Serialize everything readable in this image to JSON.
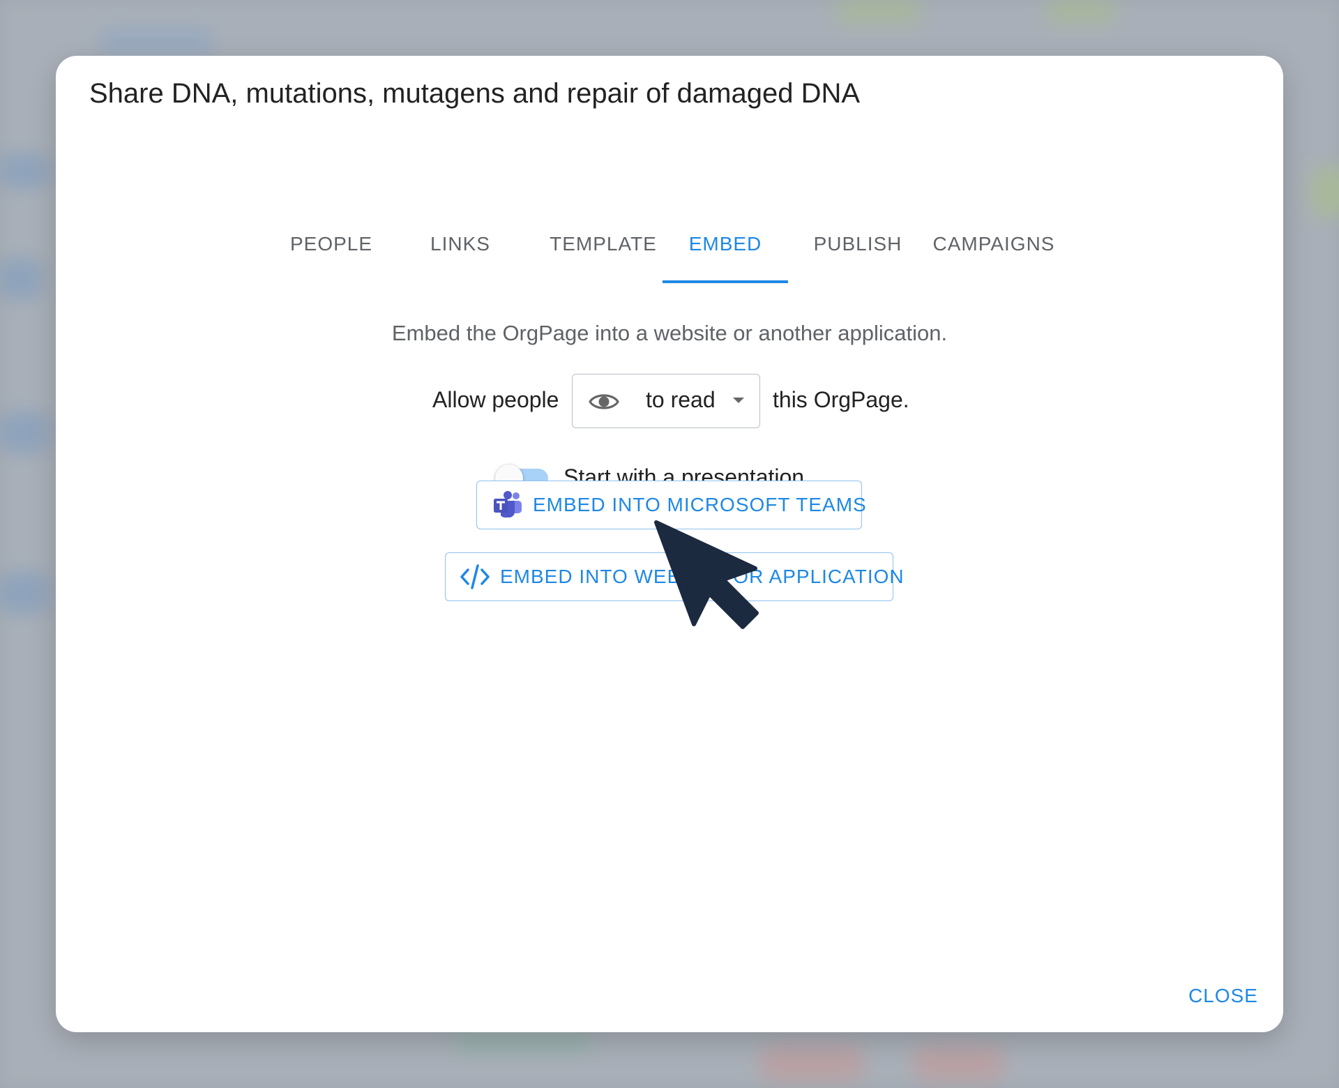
{
  "dialog": {
    "title": "Share DNA, mutations, mutagens and repair of damaged DNA",
    "close_label": "CLOSE"
  },
  "tabs": [
    {
      "label": "PEOPLE",
      "active": false
    },
    {
      "label": "LINKS",
      "active": false
    },
    {
      "label": "TEMPLATE",
      "active": false
    },
    {
      "label": "EMBED",
      "active": true
    },
    {
      "label": "PUBLISH",
      "active": false
    },
    {
      "label": "CAMPAIGNS",
      "active": false
    }
  ],
  "embed": {
    "description": "Embed the OrgPage into a website or another application.",
    "allow_prefix": "Allow people",
    "permission_value": "to read",
    "permission_icon": "eye-icon",
    "allow_suffix": "this OrgPage.",
    "presentation_toggle_label": "Start with a presentation.",
    "presentation_toggle_on": false,
    "teams_button_label": "EMBED INTO MICROSOFT TEAMS",
    "teams_icon": "microsoft-teams-icon",
    "website_button_label": "EMBED INTO WEBSITE OR APPLICATION",
    "website_icon": "code-icon"
  },
  "colors": {
    "accent": "#1e88e5",
    "teams_purple": "#5059c9",
    "cursor": "#1c2a40"
  }
}
